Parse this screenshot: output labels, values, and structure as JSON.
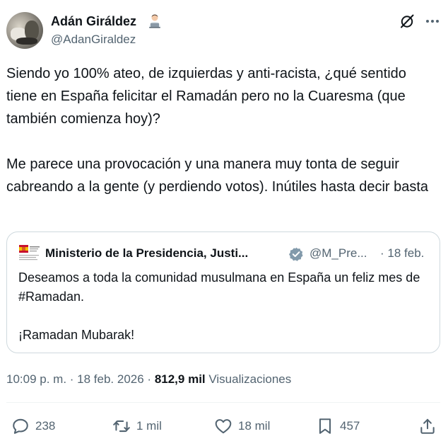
{
  "author": {
    "display_name": "Adán Giráldez",
    "handle": "@AdanGiraldez",
    "name_emoji": "technologist-emoji"
  },
  "tweet": {
    "text": "Siendo yo 100% ateo, de izquierdas y anti-racista, ¿qué sentido tiene en España felicitar el Ramadán pero no la Cuaresma (que también comienza hoy)?\n\nMe parece una provocación y una manera muy tonta de seguir cabreando a la gente (y perdiendo votos). Inútiles hasta decir basta"
  },
  "quote": {
    "display_name": "Ministerio de la Presidencia, Justi...",
    "handle": "@M_Pre...",
    "date": "· 18 feb.",
    "text": "Deseamos a toda la comunidad musulmana en España un feliz mes de #Ramadan.\n\n¡Ramadan Mubarak!",
    "verified_color": "#829aab"
  },
  "meta": {
    "time": "10:09 p. m.",
    "sep1": " · ",
    "date": "18 feb. 2026",
    "sep2": " · ",
    "views_count": "812,9 mil",
    "views_label": " Visualizaciones"
  },
  "actions": {
    "replies": "238",
    "reposts": "1 mil",
    "likes": "18 mil",
    "bookmarks": "457"
  },
  "icons": {
    "header": [
      "grok-icon",
      "more-icon"
    ],
    "actions": [
      "reply-icon",
      "repost-icon",
      "like-icon",
      "bookmark-icon",
      "share-icon"
    ]
  },
  "colors": {
    "text": "#0f1419",
    "secondary": "#536471",
    "border": "#cfd9de"
  }
}
